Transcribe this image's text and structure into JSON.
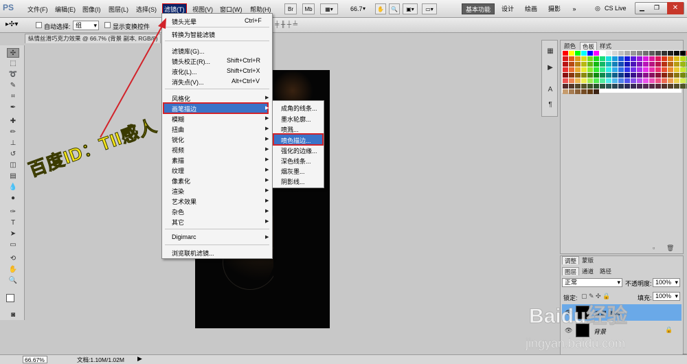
{
  "app": {
    "logo": "PS"
  },
  "menubar": {
    "items": [
      "文件(F)",
      "编辑(E)",
      "图像(I)",
      "图层(L)",
      "选择(S)",
      "滤镜(T)",
      "视图(V)",
      "窗口(W)",
      "帮助(H)"
    ],
    "active_item": "滤镜(T)",
    "zoom_level": "66.7",
    "toolbar_buttons": [
      "Br",
      "Mb"
    ],
    "workspaces": [
      "基本功能",
      "设计",
      "绘画",
      "摄影"
    ],
    "active_workspace": "基本功能",
    "more": "»",
    "cs_live": "CS Live"
  },
  "options_bar": {
    "auto_select_label": "自动选择:",
    "auto_select_value": "组",
    "show_transform_label": "显示变换控件"
  },
  "document": {
    "tab_title": "纵情丝滑巧克力效果 @ 66.7% (背景 副本, RGB/8)"
  },
  "filter_menu": {
    "items": [
      {
        "label": "镜头光晕",
        "shortcut": "Ctrl+F"
      },
      {
        "label": "转换为智能滤镜",
        "shortcut": ""
      },
      {
        "label": "滤镜库(G)...",
        "shortcut": ""
      },
      {
        "label": "镜头校正(R)...",
        "shortcut": "Shift+Ctrl+R"
      },
      {
        "label": "液化(L)...",
        "shortcut": "Shift+Ctrl+X"
      },
      {
        "label": "消失点(V)...",
        "shortcut": "Alt+Ctrl+V"
      },
      {
        "label": "风格化",
        "shortcut": ""
      },
      {
        "label": "画笔描边",
        "shortcut": ""
      },
      {
        "label": "模糊",
        "shortcut": ""
      },
      {
        "label": "扭曲",
        "shortcut": ""
      },
      {
        "label": "锐化",
        "shortcut": ""
      },
      {
        "label": "视频",
        "shortcut": ""
      },
      {
        "label": "素描",
        "shortcut": ""
      },
      {
        "label": "纹理",
        "shortcut": ""
      },
      {
        "label": "像素化",
        "shortcut": ""
      },
      {
        "label": "渲染",
        "shortcut": ""
      },
      {
        "label": "艺术效果",
        "shortcut": ""
      },
      {
        "label": "杂色",
        "shortcut": ""
      },
      {
        "label": "其它",
        "shortcut": ""
      },
      {
        "label": "Digimarc",
        "shortcut": ""
      },
      {
        "label": "浏览联机滤镜...",
        "shortcut": ""
      }
    ],
    "highlighted": "画笔描边"
  },
  "brush_submenu": {
    "items": [
      "成角的线条...",
      "墨水轮廓...",
      "喷溅...",
      "喷色描边...",
      "强化的边缘...",
      "深色线条...",
      "烟灰墨...",
      "阴影线..."
    ],
    "highlighted": "喷色描边..."
  },
  "panels": {
    "swatch_tabs": [
      "颜色",
      "色板",
      "样式"
    ],
    "active_swatch_tab": "色板",
    "adjust_tabs": [
      "调整",
      "蒙版"
    ],
    "layer_tabs": [
      "图层",
      "通道",
      "路径"
    ],
    "active_layer_tab": "图层",
    "blend_mode": "正常",
    "opacity_label": "不透明度:",
    "opacity_value": "100%",
    "lock_label": "锁定:",
    "fill_label": "填充:",
    "fill_value": "100%",
    "layers": [
      {
        "name": "背景 副本",
        "selected": true
      },
      {
        "name": "背景",
        "selected": false
      }
    ]
  },
  "status": {
    "zoom": "66.67%",
    "doc_size": "文档:1.10M/1.02M"
  },
  "overlays": {
    "author_watermark": "百度ID：TII感人",
    "baidu_watermark": "Baidu经验",
    "baidu_url": "jingyan.baidu.com"
  },
  "colors": {
    "menu_highlight": "#3a73c8",
    "annotation_red": "#d2232a",
    "watermark_yellow": "#f5e61a"
  }
}
